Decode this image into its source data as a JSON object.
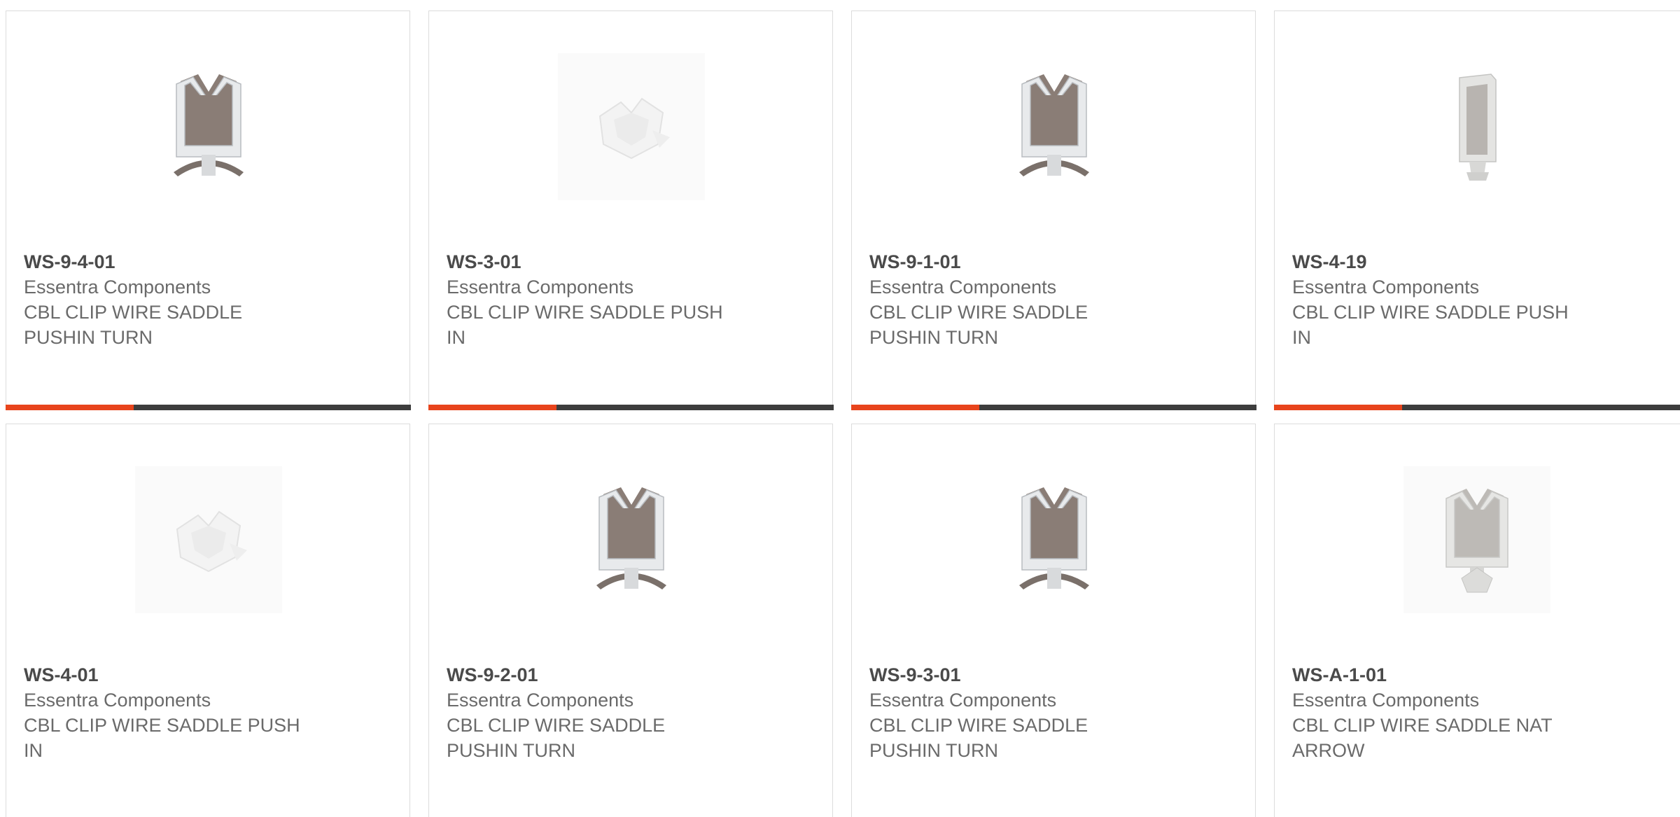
{
  "colors": {
    "accent": "#e8441c",
    "bar": "#3d3d3d",
    "border": "#dcdcdc"
  },
  "products": [
    {
      "part_number": "WS-9-4-01",
      "manufacturer": "Essentra Components",
      "desc_line1": "CBL CLIP WIRE SADDLE",
      "desc_line2": "PUSHIN TURN",
      "image_icon": "cable-clip-saddle-brown"
    },
    {
      "part_number": "WS-3-01",
      "manufacturer": "Essentra Components",
      "desc_line1": "CBL CLIP WIRE SADDLE PUSH",
      "desc_line2": "IN",
      "image_icon": "cable-clip-saddle-white"
    },
    {
      "part_number": "WS-9-1-01",
      "manufacturer": "Essentra Components",
      "desc_line1": "CBL CLIP WIRE SADDLE",
      "desc_line2": "PUSHIN TURN",
      "image_icon": "cable-clip-saddle-brown"
    },
    {
      "part_number": "WS-4-19",
      "manufacturer": "Essentra Components",
      "desc_line1": "CBL CLIP WIRE SADDLE PUSH",
      "desc_line2": "IN",
      "image_icon": "cable-clip-saddle-tall-white"
    },
    {
      "part_number": "WS-4-01",
      "manufacturer": "Essentra Components",
      "desc_line1": "CBL CLIP WIRE SADDLE PUSH",
      "desc_line2": "IN",
      "image_icon": "cable-clip-saddle-white"
    },
    {
      "part_number": "WS-9-2-01",
      "manufacturer": "Essentra Components",
      "desc_line1": "CBL CLIP WIRE SADDLE",
      "desc_line2": "PUSHIN TURN",
      "image_icon": "cable-clip-saddle-brown"
    },
    {
      "part_number": "WS-9-3-01",
      "manufacturer": "Essentra Components",
      "desc_line1": "CBL CLIP WIRE SADDLE",
      "desc_line2": "PUSHIN TURN",
      "image_icon": "cable-clip-saddle-brown"
    },
    {
      "part_number": "WS-A-1-01",
      "manufacturer": "Essentra Components",
      "desc_line1": "CBL CLIP WIRE SADDLE NAT",
      "desc_line2": "ARROW",
      "image_icon": "cable-clip-saddle-arrow-grey"
    }
  ]
}
